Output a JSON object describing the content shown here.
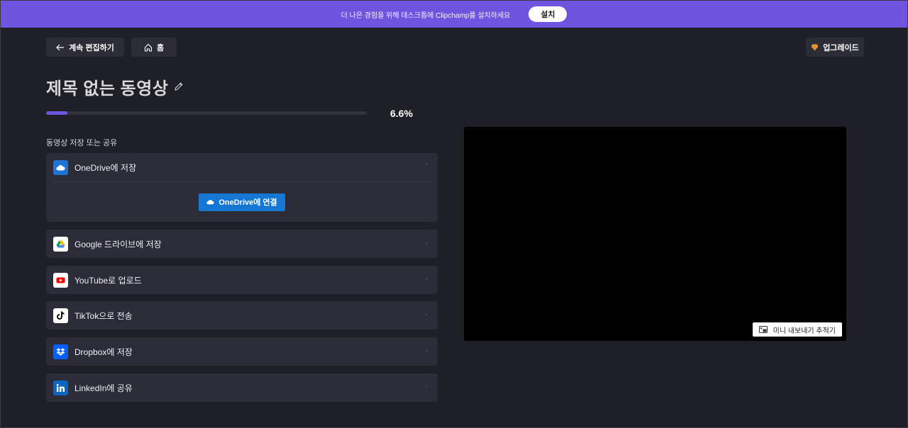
{
  "banner": {
    "text": "더 나은 경험을 위해 데스크톱에 Clipchamp를 설치하세요",
    "install_label": "설치",
    "color": "#6e55e0"
  },
  "nav": {
    "back_label": "계속 편집하기",
    "home_label": "홈",
    "upgrade_label": "업그레이드"
  },
  "title": "제목 없는 동영상",
  "progress": {
    "value": 0.066,
    "label": "6.6%"
  },
  "section_label": "동영상 저장 또는 공유",
  "destinations": [
    {
      "id": "onedrive",
      "label": "OneDrive에 저장",
      "icon": "onedrive-cloud-icon",
      "expanded": true,
      "connect_label": "OneDrive에 연결"
    },
    {
      "id": "google",
      "label": "Google 드라이브에 저장",
      "icon": "google-drive-icon"
    },
    {
      "id": "youtube",
      "label": "YouTube로 업로드",
      "icon": "youtube-icon"
    },
    {
      "id": "tiktok",
      "label": "TikTok으로 전송",
      "icon": "tiktok-icon"
    },
    {
      "id": "dropbox",
      "label": "Dropbox에 저장",
      "icon": "dropbox-icon"
    },
    {
      "id": "linkedin",
      "label": "LinkedIn에 공유",
      "icon": "linkedin-icon"
    }
  ],
  "preview": {
    "mini_export_label": "미니 내보내기 추적기"
  }
}
